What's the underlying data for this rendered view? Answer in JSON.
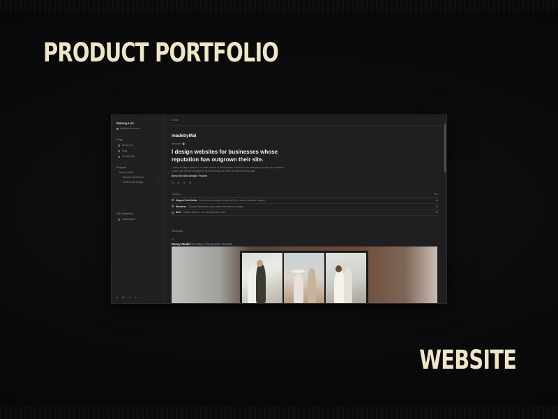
{
  "slide": {
    "headline": "PRODUCT PORTFOLIO",
    "footer_tag": "WEBSITE"
  },
  "sidebar": {
    "workspace_name": "Malang Lim",
    "workspace_status": "Available for work",
    "page_label": "Page",
    "page_items": [
      "About me",
      "Blog",
      "Contact Me"
    ],
    "projects_label": "Projects",
    "projects": [
      "Danny Studio",
      "Website Wed Studio",
      "CHRIS Visit Design"
    ],
    "workshop_label": "My Workshop",
    "workshop_item": "madebyMal",
    "bottom_items": [
      "ft",
      "Ab",
      "If",
      "ln"
    ]
  },
  "topbar": {
    "breadcrumb": "Home"
  },
  "main": {
    "brand": "madebyMal",
    "welcome": "Welcome 👋",
    "hero": "I design websites for businesses whose reputation has outgrown their site.",
    "description": "I hold a boutique idea, but an older version of the business. I build the one that keeps up with your ambition, so the right clients recognize it, and the wrong ones filter out before the first call.",
    "builder": "Bendi for Web Design / Framer",
    "social_icons": [
      "x-icon",
      "instagram-icon",
      "pinterest-icon",
      "mail-icon"
    ]
  },
  "projects_table": {
    "header_left": "Highlight",
    "header_right": "Year",
    "rows": [
      {
        "name": "Mapped Hub Dallas",
        "desc": "A tech-savvy website concept built for a service provider network",
        "year": "25"
      },
      {
        "name": "Wanderer",
        "desc": "Discover wild places and custom local travel concepts",
        "year": "24"
      },
      {
        "name": "Bobi",
        "desc": "Product site for a fun, friendly photo editor",
        "year": "24"
      }
    ]
  },
  "showcase": {
    "label": "Showcase",
    "number": "01",
    "title_bold": "Danny Studio",
    "title_rest": "Wedding Photographer Website"
  }
}
